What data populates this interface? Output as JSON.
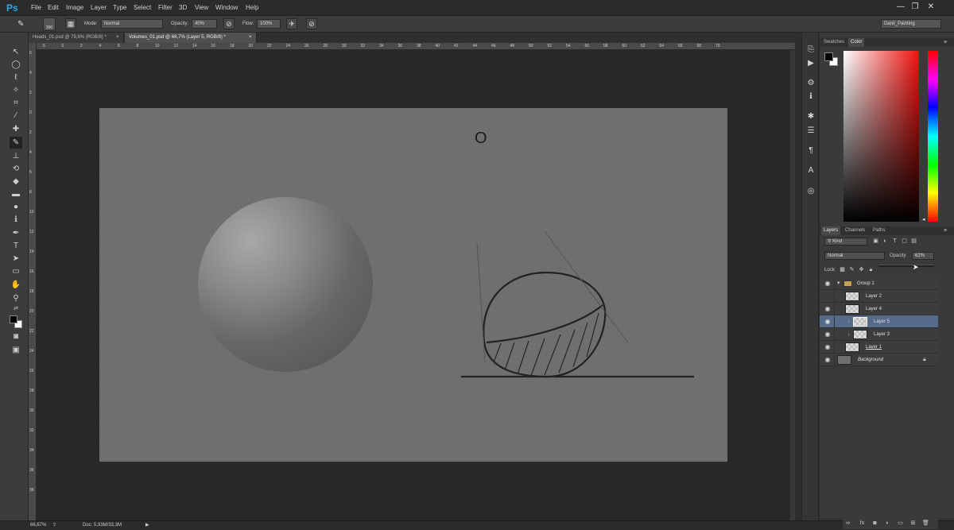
{
  "app": {
    "logo": "Ps"
  },
  "menu": [
    "File",
    "Edit",
    "Image",
    "Layer",
    "Type",
    "Select",
    "Filter",
    "3D",
    "View",
    "Window",
    "Help"
  ],
  "window_controls": {
    "minimize": "—",
    "restore": "❐",
    "close": "✕"
  },
  "options_bar": {
    "brush_size": "300",
    "mode_label": "Mode:",
    "mode_value": "Normal",
    "opacity_label": "Opacity:",
    "opacity_value": "40%",
    "flow_label": "Flow:",
    "flow_value": "100%",
    "workspace": "Danil_Painting"
  },
  "tabs": [
    {
      "label": "Heads_01.psd @ 79,6% (RGB/8) *",
      "close": "×"
    },
    {
      "label": "Volumes_01.psd @ 66,7% (Layer 5, RGB/8) *",
      "close": "×"
    }
  ],
  "ruler_top": [
    "6",
    "0",
    "2",
    "4",
    "6",
    "8",
    "10",
    "12",
    "14",
    "16",
    "18",
    "20",
    "22",
    "24",
    "26",
    "28",
    "30",
    "32",
    "34",
    "36",
    "38",
    "40",
    "42",
    "44",
    "46",
    "48",
    "50",
    "52",
    "54",
    "56",
    "58",
    "60",
    "62",
    "64",
    "66",
    "68",
    "70"
  ],
  "ruler_left": [
    "6",
    "4",
    "2",
    "0",
    "2",
    "4",
    "6",
    "8",
    "10",
    "12",
    "14",
    "16",
    "18",
    "20",
    "22",
    "24",
    "26",
    "28",
    "30",
    "32",
    "34",
    "36",
    "38"
  ],
  "canvas": {
    "cursor_glyph": "O"
  },
  "status": {
    "zoom": "66,67%",
    "doc": "Doc: 5,93M/33,3M",
    "arrow": "▶"
  },
  "color_panel": {
    "tabs": [
      "Swatches",
      "Color"
    ],
    "active": "Color",
    "fg": "#000000",
    "bg": "#ffffff"
  },
  "layers_panel": {
    "tabs": [
      "Layers",
      "Channels",
      "Paths"
    ],
    "active": "Layers",
    "filter": "Kind",
    "blend_mode": "Normal",
    "opacity_label": "Opacity:",
    "opacity_value": "62%",
    "lock_label": "Lock:",
    "layers": [
      {
        "name": "Group 1",
        "visible": true,
        "type": "group"
      },
      {
        "name": "Layer 2",
        "visible": false,
        "type": "layer"
      },
      {
        "name": "Layer 4",
        "visible": true,
        "type": "layer"
      },
      {
        "name": "Layer 5",
        "visible": true,
        "type": "layer",
        "selected": true
      },
      {
        "name": "Layer 3",
        "visible": true,
        "type": "layer"
      },
      {
        "name": "Layer 1",
        "visible": true,
        "type": "layer"
      },
      {
        "name": "Background",
        "visible": true,
        "type": "background"
      }
    ],
    "footer_icons": [
      "link-icon",
      "fx-icon",
      "mask-icon",
      "adjustment-icon",
      "folder-icon",
      "new-layer-icon",
      "trash-icon"
    ]
  }
}
